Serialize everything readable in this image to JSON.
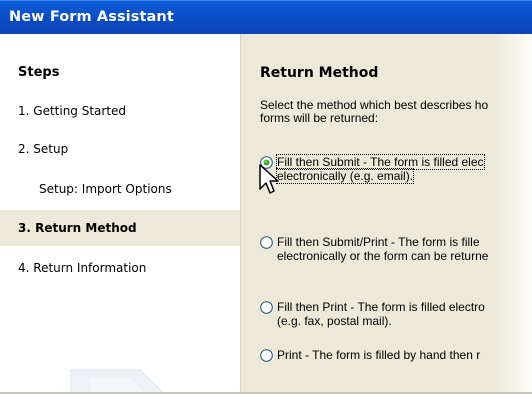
{
  "window": {
    "title": "New Form Assistant"
  },
  "steps": {
    "heading": "Steps",
    "items": [
      {
        "label": "1. Getting Started"
      },
      {
        "label": "2. Setup"
      },
      {
        "label": "Setup: Import Options"
      },
      {
        "label": "3. Return Method",
        "selected": true
      },
      {
        "label": "4. Return Information"
      }
    ]
  },
  "main": {
    "title": "Return Method",
    "description_line1": "Select the method which best describes ho",
    "description_line2": "forms will be returned:",
    "options": [
      {
        "line1": "Fill then Submit  -  The form is filled elec",
        "line2": "electronically (e.g. email).",
        "checked": true
      },
      {
        "line1": "Fill then Submit/Print  -  The form is fille",
        "line2": "electronically or the form can be returne",
        "checked": false
      },
      {
        "line1": "Fill then Print  -  The form is filled electro",
        "line2": "(e.g. fax, postal mail).",
        "checked": false
      },
      {
        "line1": "Print  -  The form is filled by hand then r",
        "checked": false
      }
    ]
  },
  "colors": {
    "titlebar": "#0a4bc2",
    "selected_step_bg": "#ece9d8",
    "radio_checked": "#3fae2a"
  },
  "icons": {
    "cursor": "mouse-pointer-icon",
    "radio": "radio-button-icon"
  }
}
